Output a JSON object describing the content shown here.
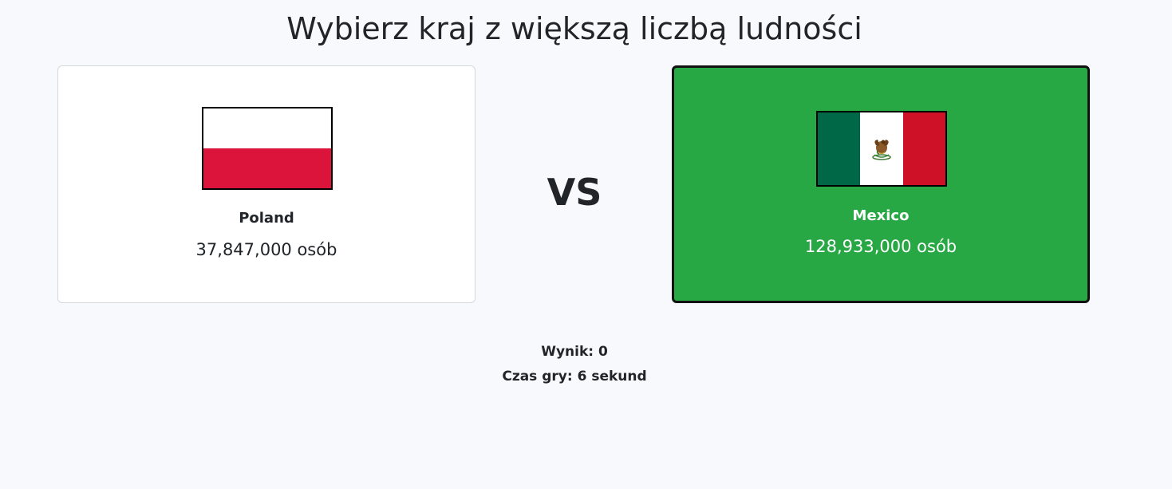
{
  "title": "Wybierz kraj z większą liczbą ludności",
  "vs_label": "VS",
  "left": {
    "country": "Poland",
    "population": "37,847,000 osób",
    "flag_colors": [
      "#ffffff",
      "#dc143c"
    ],
    "selected": false
  },
  "right": {
    "country": "Mexico",
    "population": "128,933,000 osób",
    "flag_colors": [
      "#006847",
      "#ffffff",
      "#ce1126"
    ],
    "emblem": "eagle-emblem-icon",
    "selected": true,
    "highlight_color": "#28a745"
  },
  "score": "Wynik: 0",
  "time": "Czas gry: 6 sekund"
}
